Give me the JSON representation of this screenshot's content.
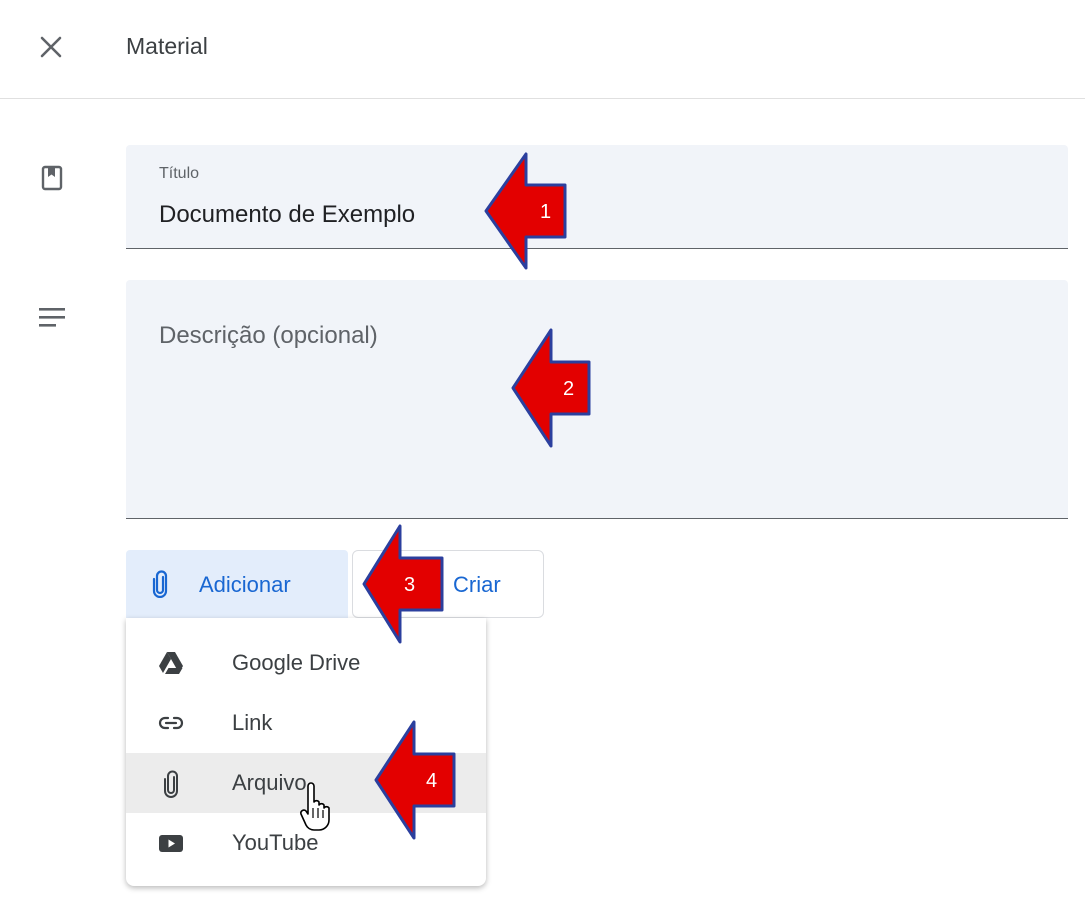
{
  "header": {
    "title": "Material",
    "close_icon": "close-icon"
  },
  "form": {
    "title_label": "Título",
    "title_value": "Documento de Exemplo",
    "description_placeholder": "Descrição (opcional)"
  },
  "actions": {
    "add_label": "Adicionar",
    "create_label": "Criar"
  },
  "menu": {
    "items": [
      {
        "label": "Google Drive",
        "icon": "google-drive-icon"
      },
      {
        "label": "Link",
        "icon": "link-icon"
      },
      {
        "label": "Arquivo",
        "icon": "paperclip-icon"
      },
      {
        "label": "YouTube",
        "icon": "youtube-icon"
      }
    ]
  },
  "callouts": [
    "1",
    "2",
    "3",
    "4"
  ],
  "colors": {
    "accent": "#1967d2",
    "field_bg": "#f1f4f9",
    "add_button_bg": "#e3edfb",
    "arrow_red": "#e30000",
    "arrow_border": "#2b3f9e"
  }
}
